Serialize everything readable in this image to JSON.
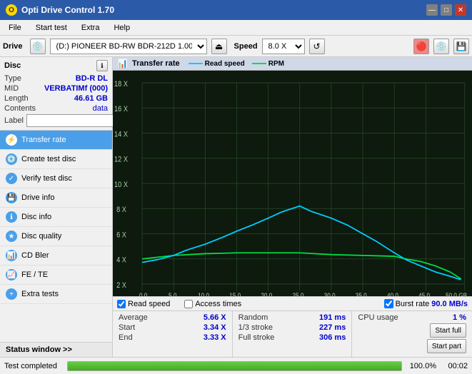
{
  "titleBar": {
    "title": "Opti Drive Control 1.70",
    "icon": "O"
  },
  "menu": {
    "items": [
      "File",
      "Start test",
      "Extra",
      "Help"
    ]
  },
  "toolbar": {
    "driveLabel": "Drive",
    "driveValue": "(D:)  PIONEER BD-RW   BDR-212D 1.00",
    "speedLabel": "Speed",
    "speedValue": "8.0 X"
  },
  "disc": {
    "title": "Disc",
    "rows": [
      {
        "key": "Type",
        "value": "BD-R DL",
        "colored": true
      },
      {
        "key": "MID",
        "value": "VERBATIMf (000)",
        "colored": true
      },
      {
        "key": "Length",
        "value": "46.61 GB",
        "colored": false
      },
      {
        "key": "Contents",
        "value": "data",
        "colored": true
      }
    ],
    "labelKey": "Label",
    "labelPlaceholder": ""
  },
  "nav": {
    "items": [
      {
        "id": "transfer-rate",
        "label": "Transfer rate",
        "active": true
      },
      {
        "id": "create-test-disc",
        "label": "Create test disc",
        "active": false
      },
      {
        "id": "verify-test-disc",
        "label": "Verify test disc",
        "active": false
      },
      {
        "id": "drive-info",
        "label": "Drive info",
        "active": false
      },
      {
        "id": "disc-info",
        "label": "Disc info",
        "active": false
      },
      {
        "id": "disc-quality",
        "label": "Disc quality",
        "active": false
      },
      {
        "id": "cd-bler",
        "label": "CD Bler",
        "active": false
      },
      {
        "id": "fe-te",
        "label": "FE / TE",
        "active": false
      },
      {
        "id": "extra-tests",
        "label": "Extra tests",
        "active": false
      }
    ]
  },
  "statusWindow": {
    "label": "Status window >> "
  },
  "chart": {
    "title": "Transfer rate",
    "legend": {
      "readSpeed": "Read speed",
      "rpm": "RPM"
    },
    "yAxis": [
      "18 X",
      "16 X",
      "14 X",
      "12 X",
      "10 X",
      "8 X",
      "6 X",
      "4 X",
      "2 X"
    ],
    "xAxis": [
      "0.0",
      "5.0",
      "10.0",
      "15.0",
      "20.0",
      "25.0",
      "30.0",
      "35.0",
      "40.0",
      "45.0",
      "50.0 GB"
    ],
    "colors": {
      "readSpeedLine": "#00ccff",
      "rpmLine": "#00dd44",
      "grid": "#2a4a2a",
      "background": "#0d1a0d"
    }
  },
  "checkboxes": {
    "readSpeed": {
      "label": "Read speed",
      "checked": true
    },
    "accessTimes": {
      "label": "Access times",
      "checked": false
    },
    "burstRate": {
      "label": "Burst rate",
      "checked": true,
      "value": "90.0 MB/s"
    }
  },
  "stats": {
    "col1": [
      {
        "key": "Average",
        "value": "5.66 X"
      },
      {
        "key": "Start",
        "value": "3.34 X"
      },
      {
        "key": "End",
        "value": "3.33 X"
      }
    ],
    "col2": [
      {
        "key": "Random",
        "value": "191 ms"
      },
      {
        "key": "1/3 stroke",
        "value": "227 ms"
      },
      {
        "key": "Full stroke",
        "value": "306 ms"
      }
    ],
    "col3": [
      {
        "key": "CPU usage",
        "value": "1 %"
      },
      {
        "btn1": "Start full"
      },
      {
        "btn2": "Start part"
      }
    ]
  },
  "statusBar": {
    "text": "Test completed",
    "progress": 100,
    "progressLabel": "100.0%",
    "elapsed": "00:02"
  }
}
